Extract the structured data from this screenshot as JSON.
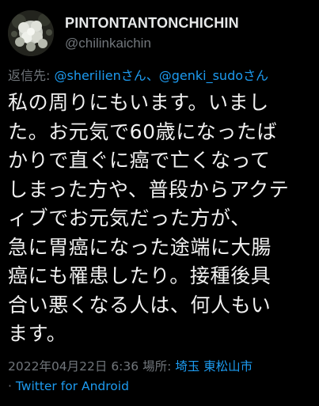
{
  "tweet": {
    "display_name": "PINTONTANTONCHICHIN",
    "handle": "@chilinkaichin",
    "reply": {
      "prefix": "返信先: ",
      "mention_1": "@sherilienさん",
      "separator": "、",
      "mention_2": "@genki_sudoさん"
    },
    "body_lines": [
      "私の周りにもいます。いまし",
      "た。お元気で60歳になったば",
      "かりで直ぐに癌で亡くなって",
      "しまった方や、普段からアクテ",
      "ィブでお元気だった方が、",
      "急に胃癌になった途端に大腸",
      "癌にも罹患したり。接種後具",
      "合い悪くなる人は、何人もい",
      "ます。"
    ],
    "timestamp": "2022年04月22日 6:36",
    "location_label": " 場所: ",
    "location": "埼玉 東松山市",
    "source_prefix": "· ",
    "source": "Twitter for Android"
  },
  "colors": {
    "background": "#000000",
    "text": "#e7e9ea",
    "secondary": "#71767b",
    "link": "#1d9bf0"
  },
  "icons": {
    "avatar": "flower-avatar-image"
  }
}
